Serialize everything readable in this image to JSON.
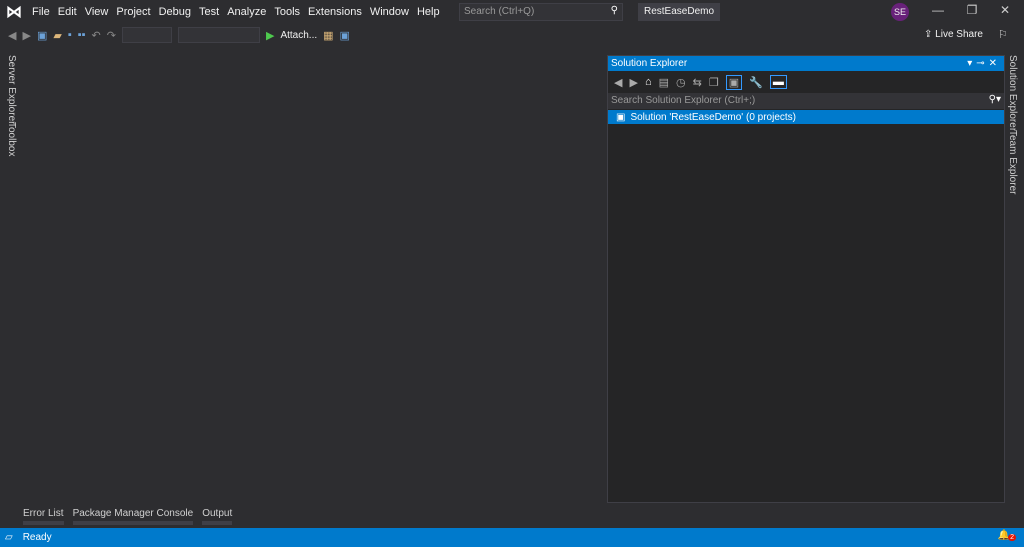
{
  "menu": {
    "items": [
      "File",
      "Edit",
      "View",
      "Project",
      "Debug",
      "Test",
      "Analyze",
      "Tools",
      "Extensions",
      "Window",
      "Help"
    ]
  },
  "search": {
    "placeholder": "Search (Ctrl+Q)"
  },
  "solution_title": "RestEaseDemo",
  "user_initials": "SE",
  "toolbar": {
    "attach_label": "Attach...",
    "live_share": "Live Share"
  },
  "left_sidebar": [
    "Server Explorer",
    "Toolbox"
  ],
  "right_sidebar": [
    "Solution Explorer",
    "Team Explorer"
  ],
  "solution_explorer": {
    "title": "Solution Explorer",
    "search_placeholder": "Search Solution Explorer (Ctrl+;)",
    "root": "Solution 'RestEaseDemo' (0 projects)"
  },
  "bottom_tabs": [
    "Error List",
    "Package Manager Console",
    "Output"
  ],
  "status": {
    "text": "Ready",
    "notifications": "2"
  },
  "colors": {
    "accent": "#007acc",
    "background": "#2d2d30"
  }
}
